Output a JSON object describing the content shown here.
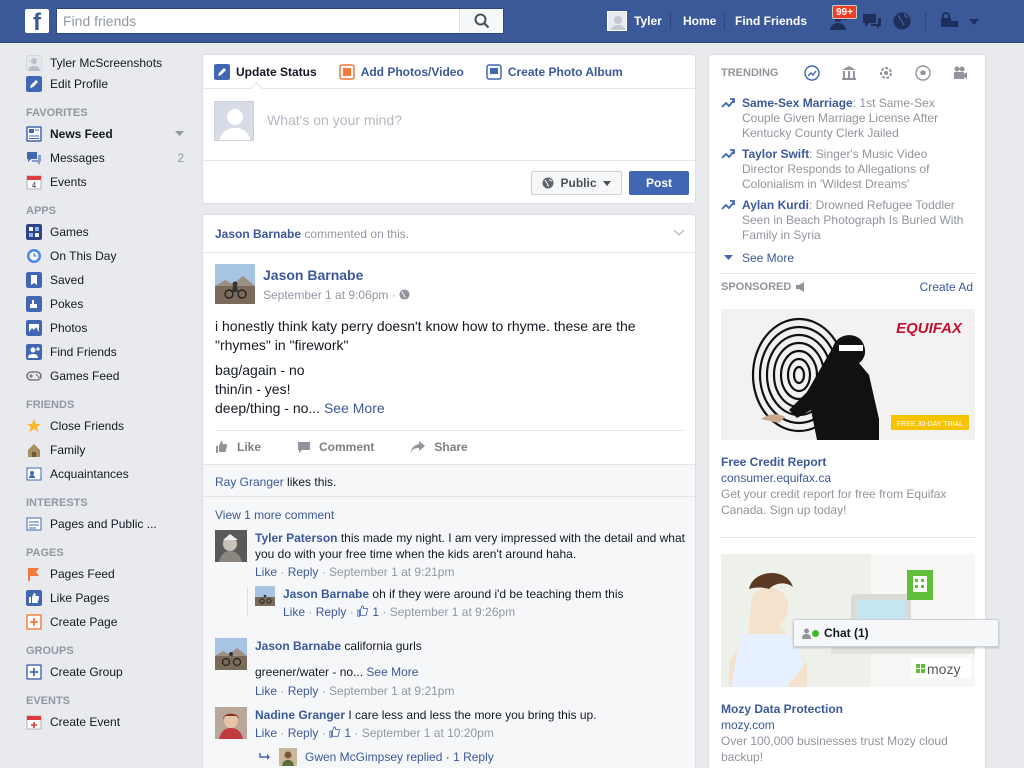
{
  "topbar": {
    "logo": "f",
    "search_placeholder": "Find friends",
    "user_name": "Tyler",
    "home": "Home",
    "find_friends": "Find Friends",
    "friend_requests_badge": "99+"
  },
  "sidebar": {
    "profile_name": "Tyler McScreenshots",
    "edit_profile": "Edit Profile",
    "favorites_header": "FAVORITES",
    "news_feed": "News Feed",
    "messages": "Messages",
    "messages_count": "2",
    "events": "Events",
    "apps_header": "APPS",
    "games": "Games",
    "on_this_day": "On This Day",
    "saved": "Saved",
    "pokes": "Pokes",
    "photos": "Photos",
    "find_friends": "Find Friends",
    "games_feed": "Games Feed",
    "friends_header": "FRIENDS",
    "close_friends": "Close Friends",
    "family": "Family",
    "acquaintances": "Acquaintances",
    "interests_header": "INTERESTS",
    "pages_and_public": "Pages and Public ...",
    "pages_header": "PAGES",
    "pages_feed": "Pages Feed",
    "like_pages": "Like Pages",
    "create_page": "Create Page",
    "groups_header": "GROUPS",
    "create_group": "Create Group",
    "events_header": "EVENTS",
    "create_event": "Create Event"
  },
  "composer": {
    "tab_status": "Update Status",
    "tab_photos": "Add Photos/Video",
    "tab_album": "Create Photo Album",
    "placeholder": "What's on your mind?",
    "privacy": "Public",
    "post": "Post"
  },
  "story": {
    "header_name": "Jason Barnabe",
    "header_action": "commented on this.",
    "author": "Jason Barnabe",
    "date": "September 1 at 9:06pm",
    "text_line1": "i honestly think katy perry doesn't know how to rhyme. these are the \"rhymes\" in \"firework\"",
    "text_line2": "bag/again - no",
    "text_line3": "thin/in - yes!",
    "text_line4": "deep/thing - no...",
    "see_more": "See More",
    "like": "Like",
    "comment": "Comment",
    "share": "Share",
    "likes_name": "Ray Granger",
    "likes_suffix": "likes this.",
    "view_more": "View 1 more comment",
    "comments": [
      {
        "name": "Tyler Paterson",
        "text": "this made my night. I am very impressed with the detail and what you do with your free time when the kids aren't around haha.",
        "like": "Like",
        "reply": "Reply",
        "time": "September 1 at 9:21pm"
      },
      {
        "name": "Jason Barnabe",
        "text": "oh if they were around i'd be teaching them this",
        "like": "Like",
        "reply": "Reply",
        "likes": "1",
        "time": "September 1 at 9:26pm"
      },
      {
        "name": "Jason Barnabe",
        "text": "california gurls",
        "text2": "greener/water - no...",
        "see_more": "See More",
        "like": "Like",
        "reply": "Reply",
        "time": "September 1 at 9:21pm"
      },
      {
        "name": "Nadine Granger",
        "text": "I care less and less the more you bring this up.",
        "like": "Like",
        "reply": "Reply",
        "likes": "1",
        "time": "September 1 at 10:20pm"
      }
    ],
    "reply_summary": "Gwen McGimpsey replied",
    "reply_count": "1 Reply"
  },
  "trending": {
    "header": "TRENDING",
    "items": [
      {
        "topic": "Same-Sex Marriage",
        "desc": "1st Same-Sex Couple Given Marriage License After Kentucky County Clerk Jailed"
      },
      {
        "topic": "Taylor Swift",
        "desc": "Singer's Music Video Director Responds to Allegations of Colonialism in 'Wildest Dreams'"
      },
      {
        "topic": "Aylan Kurdi",
        "desc": "Drowned Refugee Toddler Seen in Beach Photograph Is Buried With Family in Syria"
      }
    ],
    "see_more": "See More"
  },
  "sponsored": {
    "header": "SPONSORED",
    "create_ad": "Create Ad",
    "ads": [
      {
        "brand": "EQUIFAX",
        "cta": "FREE 30-DAY TRIAL",
        "title": "Free Credit Report",
        "url": "consumer.equifax.ca",
        "desc": "Get your credit report for free from Equifax Canada. Sign up today!"
      },
      {
        "brand": "mozy",
        "title": "Mozy Data Protection",
        "url": "mozy.com",
        "desc": "Over 100,000 businesses trust Mozy cloud backup!"
      }
    ]
  },
  "chat": {
    "label": "Chat (1)"
  },
  "colors": {
    "brand": "#3b5998",
    "link": "#3b5998",
    "meta": "#9197a3",
    "post_button": "#4267b2"
  }
}
